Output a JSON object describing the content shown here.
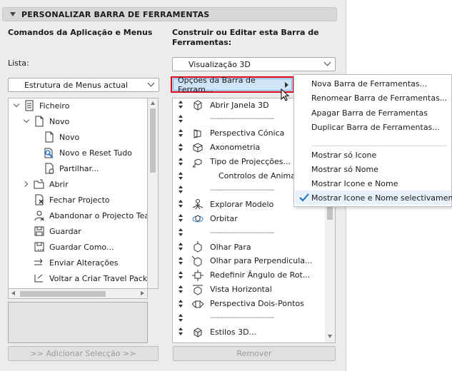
{
  "panel": {
    "title": "PERSONALIZAR BARRA DE FERRAMENTAS",
    "left_heading": "Comandos da Aplicação e Menus",
    "right_heading_line1": "Construir ou Editar esta Barra de",
    "right_heading_line2": "Ferramentas:",
    "list_label": "Lista:",
    "list_dropdown": "Estrutura de Menus actual",
    "toolbar_dropdown": "Visualização 3D",
    "add_button": ">> Adicionar Selecção >>",
    "remove_button": "Remover",
    "options_button": "Opções da Barra de Ferram..."
  },
  "tree": [
    {
      "label": "Ficheiro",
      "icon": "file-icon",
      "indent": 0,
      "expander": "down"
    },
    {
      "label": "Novo",
      "icon": "new-doc-icon",
      "indent": 1,
      "expander": "down"
    },
    {
      "label": "Novo",
      "icon": "new-doc-icon",
      "indent": 2,
      "expander": ""
    },
    {
      "label": "Novo e Reset Tudo",
      "icon": "new-reset-icon",
      "indent": 2,
      "expander": ""
    },
    {
      "label": "Partilhar...",
      "icon": "share-icon",
      "indent": 2,
      "expander": ""
    },
    {
      "label": "Abrir",
      "icon": "open-folder-icon",
      "indent": 1,
      "expander": "right"
    },
    {
      "label": "Fechar Projecto",
      "icon": "close-project-icon",
      "indent": 1,
      "expander": ""
    },
    {
      "label": "Abandonar o Projecto Team",
      "icon": "leave-team-icon",
      "indent": 1,
      "expander": ""
    },
    {
      "label": "Guardar",
      "icon": "save-icon",
      "indent": 1,
      "expander": ""
    },
    {
      "label": "Guardar Como...",
      "icon": "save-as-icon",
      "indent": 1,
      "expander": ""
    },
    {
      "label": "Enviar Alterações",
      "icon": "send-changes-icon",
      "indent": 1,
      "expander": ""
    },
    {
      "label": "Voltar a Criar Travel Pack",
      "icon": "travel-pack-icon",
      "indent": 1,
      "expander": ""
    }
  ],
  "toolbar_items": [
    {
      "label": "Abrir Janela 3D",
      "icon": "cube-icon",
      "sep": false
    },
    {
      "label": "-----------------------------",
      "icon": "",
      "sep": true
    },
    {
      "label": "Perspectiva Cónica",
      "icon": "perspective-icon",
      "sep": false
    },
    {
      "label": "Axonometria",
      "icon": "axonometry-icon",
      "sep": false
    },
    {
      "label": "Tipo de Projecções...",
      "icon": "projection-icon",
      "sep": false
    },
    {
      "label": "Controlos de Animação",
      "icon": "",
      "sep": false,
      "sub": true
    },
    {
      "label": "-----------------------------",
      "icon": "",
      "sep": true
    },
    {
      "label": "Explorar Modelo",
      "icon": "explore-icon",
      "sep": false
    },
    {
      "label": "Orbitar",
      "icon": "orbit-icon",
      "sep": false
    },
    {
      "label": "-----------------------------",
      "icon": "",
      "sep": true
    },
    {
      "label": "Olhar Para",
      "icon": "look-to-icon",
      "sep": false
    },
    {
      "label": "Olhar para Perpendicula...",
      "icon": "look-perpendicular-icon",
      "sep": false
    },
    {
      "label": "Redefinir Ângulo de Rot...",
      "icon": "reset-angle-icon",
      "sep": false
    },
    {
      "label": "Vista Horizontal",
      "icon": "horizontal-view-icon",
      "sep": false
    },
    {
      "label": "Perspectiva Dois-Pontos",
      "icon": "two-point-icon",
      "sep": false
    },
    {
      "label": "-----------------------------",
      "icon": "",
      "sep": true
    },
    {
      "label": "Estilos 3D...",
      "icon": "styles-3d-icon",
      "sep": false
    }
  ],
  "menu": {
    "items_top": [
      "Nova Barra de Ferramentas...",
      "Renomear Barra de Ferramentas...",
      "Apagar Barra de Ferramentas",
      "Duplicar Barra de Ferramentas..."
    ],
    "items_bottom": [
      "Mostrar só Icone",
      "Mostrar só Nome",
      "Mostrar Icone e Nome",
      "Mostrar Icone e Nome selectivamente"
    ],
    "checked": "Mostrar Icone e Nome selectivamente"
  },
  "colors": {
    "highlight": "#cfe4f7",
    "focus_border": "#e0001a",
    "check": "#1a6fc4"
  }
}
